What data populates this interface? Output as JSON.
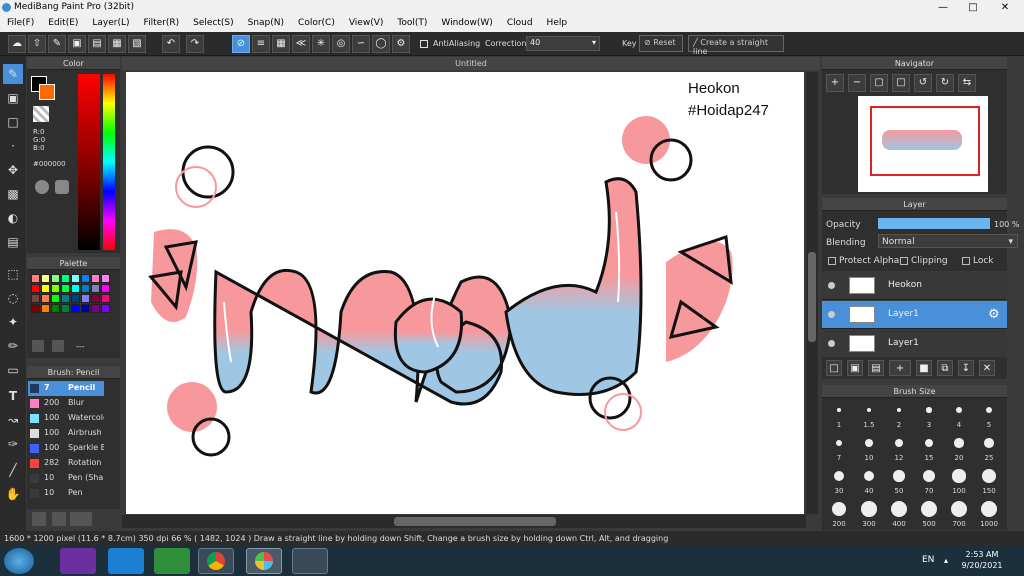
{
  "window": {
    "title": "MediBang Paint Pro (32bit)"
  },
  "menu": [
    "File(F)",
    "Edit(E)",
    "Layer(L)",
    "Filter(R)",
    "Select(S)",
    "Snap(N)",
    "Color(C)",
    "View(V)",
    "Tool(T)",
    "Window(W)",
    "Cloud",
    "Help"
  ],
  "toolbar": {
    "antialiasing_label": "AntiAliasing",
    "correction_label": "Correction",
    "correction_value": "40",
    "key_label": "Key",
    "reset_label": "Reset",
    "straight_line_label": "Create a straight line"
  },
  "color_panel": {
    "title": "Color",
    "r": "R:0",
    "g": "G:0",
    "b": "B:0",
    "hex": "#000000",
    "primary": "#000000",
    "secondary": "#ff6a00"
  },
  "palette_panel": {
    "title": "Palette",
    "colors": [
      "#ff8080",
      "#ffff80",
      "#80ff80",
      "#00ff80",
      "#80ffff",
      "#0080ff",
      "#ff80c0",
      "#ff80ff",
      "#ff0000",
      "#ffff00",
      "#80ff00",
      "#00ff40",
      "#00ffff",
      "#0080c0",
      "#8080c0",
      "#ff00ff",
      "#804040",
      "#ff8040",
      "#00ff00",
      "#008080",
      "#004080",
      "#8080ff",
      "#800040",
      "#ff0080",
      "#800000",
      "#ff8000",
      "#008000",
      "#008040",
      "#0000ff",
      "#0000a0",
      "#800080",
      "#8000ff"
    ],
    "count_label": "---"
  },
  "brush_panel": {
    "title": "Brush: Pencil",
    "brushes": [
      {
        "size": "7",
        "name": "Pencil",
        "color": "#1e3a5f"
      },
      {
        "size": "200",
        "name": "Blur",
        "color": "#ff80c0"
      },
      {
        "size": "100",
        "name": "Watercolor",
        "color": "#80e0ff"
      },
      {
        "size": "100",
        "name": "Airbrush",
        "color": "#dddddd"
      },
      {
        "size": "100",
        "name": "Sparkle B",
        "color": "#4060ff"
      },
      {
        "size": "282",
        "name": "Rotation",
        "color": "#ff4040"
      },
      {
        "size": "10",
        "name": "Pen (Sha",
        "color": "#3a3a3a"
      },
      {
        "size": "10",
        "name": "Pen",
        "color": "#3a3a3a"
      }
    ]
  },
  "document": {
    "tab": "Untitled"
  },
  "canvas_text": {
    "line1": "Heokon",
    "line2": "#Hoidap247"
  },
  "navigator_panel": {
    "title": "Navigator"
  },
  "layer_panel": {
    "title": "Layer",
    "opacity_label": "Opacity",
    "opacity_value": "100 %",
    "opacity_fraction": 1.0,
    "blending_label": "Blending",
    "blending_value": "Normal",
    "protect_alpha": "Protect Alpha",
    "clipping": "Clipping",
    "lock": "Lock",
    "layers": [
      {
        "name": "Heokon",
        "selected": false
      },
      {
        "name": "Layer1",
        "selected": true
      },
      {
        "name": "Layer1",
        "selected": false
      }
    ]
  },
  "brush_size_panel": {
    "title": "Brush Size",
    "sizes": [
      "1",
      "1.5",
      "2",
      "3",
      "4",
      "5",
      "7",
      "10",
      "12",
      "15",
      "20",
      "25",
      "30",
      "40",
      "50",
      "70",
      "100",
      "150",
      "200",
      "300",
      "400",
      "500",
      "700",
      "1000"
    ]
  },
  "status": {
    "size": "1600 * 1200 pixel",
    "cm": "(11.6 * 8.7cm)",
    "dpi": "350 dpi",
    "zoom": "66 %",
    "coords": "( 1482, 1024 )",
    "hint": "Draw a straight line by holding down Shift, Change a brush size by holding down Ctrl, Alt, and dragging"
  },
  "taskbar": {
    "lang": "EN",
    "time": "2:53 AM",
    "date": "9/20/2021"
  }
}
